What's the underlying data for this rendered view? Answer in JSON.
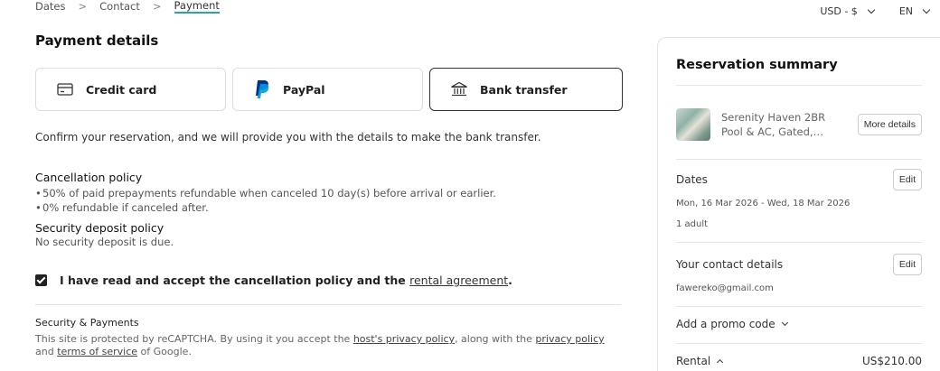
{
  "breadcrumb": {
    "items": [
      "Dates",
      "Contact",
      "Payment"
    ],
    "separator": ">"
  },
  "topright": {
    "currency": "USD - $",
    "language": "EN"
  },
  "title": "Payment details",
  "methods": [
    {
      "label": "Credit card",
      "icon": "credit-card-icon",
      "selected": false
    },
    {
      "label": "PayPal",
      "icon": "paypal-icon",
      "selected": false
    },
    {
      "label": "Bank transfer",
      "icon": "bank-icon",
      "selected": true
    }
  ],
  "confirm_text": "Confirm your reservation, and we will provide you with the details to make the bank transfer.",
  "cancellation": {
    "heading": "Cancellation policy",
    "items": [
      "50% of paid prepayments refundable when canceled 10 day(s) before arrival or earlier.",
      "0% refundable if canceled after."
    ]
  },
  "deposit": {
    "heading": "Security deposit policy",
    "text": "No security deposit is due."
  },
  "accept": {
    "text": "I have read and accept the cancellation policy and the ",
    "link": "rental agreement",
    "suffix": ".",
    "checked": true
  },
  "security": {
    "heading": "Security & Payments",
    "text1": "This site is protected by reCAPTCHA. By using it you accept the ",
    "link1": "host's privacy policy",
    "text2": ", along with the ",
    "link2": "privacy policy",
    "text3": " and ",
    "link3": "terms of service",
    "text4": " of Google."
  },
  "summary": {
    "title": "Reservation summary",
    "property_name": "Serenity Haven 2BR Pool & AC, Gated,…",
    "more_details": "More details",
    "dates_label": "Dates",
    "dates_value": "Mon, 16 Mar 2026 - Wed, 18 Mar 2026",
    "guests": "1 adult",
    "contact_label": "Your contact details",
    "contact_email": "fawereko@gmail.com",
    "edit": "Edit",
    "promo": "Add a promo code",
    "rental_label": "Rental",
    "rental_value": "US$210.00"
  },
  "colors": {
    "accent": "#2ea3a3",
    "paypal_dark": "#003087",
    "paypal_light": "#009cde"
  }
}
